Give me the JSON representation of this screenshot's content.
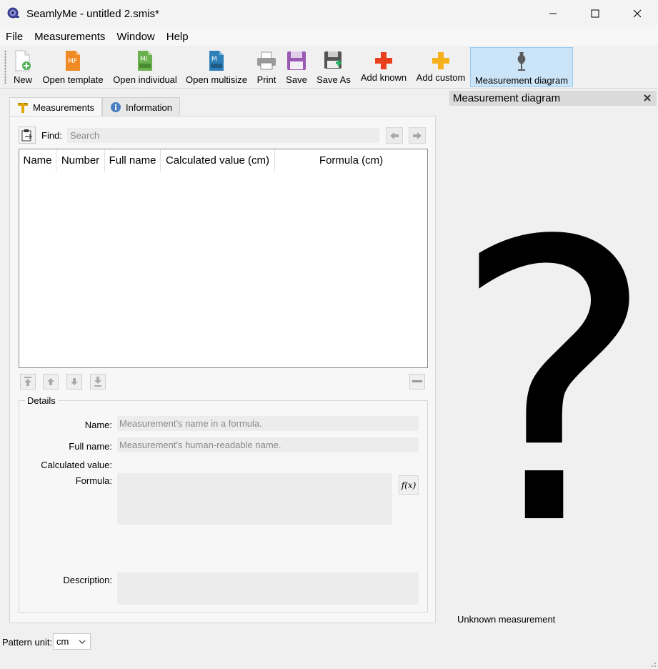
{
  "window": {
    "title": "SeamlyMe - untitled 2.smis*",
    "controls": [
      "minimize-icon",
      "maximize-icon",
      "close-icon"
    ]
  },
  "menu": [
    "File",
    "Measurements",
    "Window",
    "Help"
  ],
  "toolbar": [
    {
      "label": "New",
      "icon": "new-document-icon"
    },
    {
      "label": "Open template",
      "icon": "open-template-icon"
    },
    {
      "label": "Open individual",
      "icon": "open-individual-icon"
    },
    {
      "label": "Open multisize",
      "icon": "open-multisize-icon"
    },
    {
      "label": "Print",
      "icon": "printer-icon"
    },
    {
      "label": "Save",
      "icon": "floppy-icon"
    },
    {
      "label": "Save As",
      "icon": "floppy-save-as-icon"
    },
    {
      "label": "Add known",
      "icon": "plus-red-icon"
    },
    {
      "label": "Add custom",
      "icon": "plus-yellow-icon"
    },
    {
      "label": "Measurement diagram",
      "icon": "dress-form-icon",
      "active": true
    }
  ],
  "tabs": [
    {
      "label": "Measurements",
      "icon": "ruler-icon",
      "selected": true
    },
    {
      "label": "Information",
      "icon": "info-icon",
      "selected": false
    }
  ],
  "find": {
    "label": "Find:",
    "placeholder": "Search"
  },
  "table": {
    "columns": [
      "Name",
      "Number",
      "Full name",
      "Calculated value (cm)",
      "Formula (cm)"
    ],
    "rows": []
  },
  "details": {
    "title": "Details",
    "name_label": "Name:",
    "name_placeholder": "Measurement's name in a formula.",
    "fullname_label": "Full name:",
    "fullname_placeholder": "Measurement's human-readable name.",
    "calculated_label": "Calculated value:",
    "formula_label": "Formula:",
    "description_label": "Description:",
    "fx_label": "f(x)"
  },
  "status": {
    "unit_label": "Pattern unit:",
    "unit_value": "cm"
  },
  "dock": {
    "title": "Measurement diagram",
    "glyph": "?",
    "caption": "Unknown measurement"
  },
  "colors": {
    "accent": "#cce4f7",
    "accent_border": "#99c9ef",
    "add_known": "#e8401c",
    "add_custom": "#f5b21c"
  }
}
